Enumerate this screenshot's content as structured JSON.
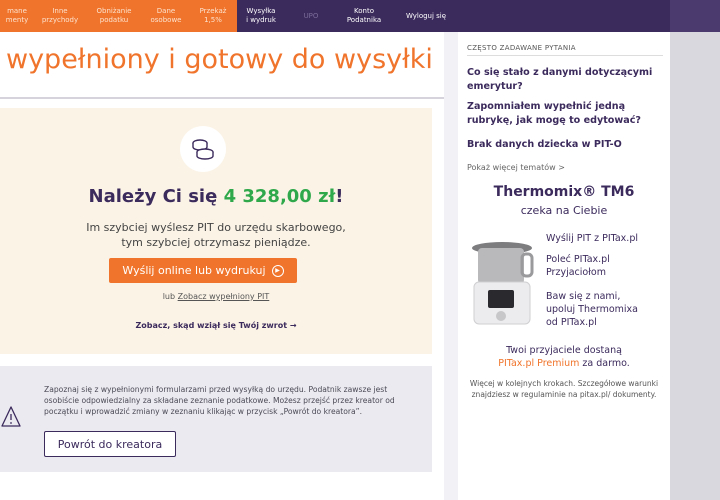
{
  "nav": {
    "steps": [
      {
        "label": "mane\nmenty"
      },
      {
        "label": "Inne\nprzychody"
      },
      {
        "label": "Obniżanie\npodatku"
      },
      {
        "label": "Dane\nosobowe"
      },
      {
        "label": "Przekaż\n1,5%"
      },
      {
        "label": "Wysyłka\ni wydruk"
      },
      {
        "label": "UPO"
      }
    ],
    "account": "Konto\nPodatnika",
    "logout": "Wyloguj się"
  },
  "main": {
    "headline": "wypełniony i gotowy do wysyłki",
    "refund_prefix": "Należy Ci się ",
    "refund_amount": "4 328,00 zł",
    "refund_suffix": "!",
    "sub_line1": "Im szybciej wyślesz PIT do urzędu skarbowego,",
    "sub_line2": "tym szybciej otrzymasz pieniądze.",
    "send_button": "Wyślij online lub wydrukuj",
    "or_text": "lub ",
    "see_pit_link": "Zobacz wypełniony PIT",
    "why_link": "Zobacz, skąd wziął się Twój zwrot",
    "info_text": "Zapoznaj się z wypełnionymi formularzami przed wysyłką do urzędu. Podatnik zawsze jest osobiście odpowiedzialny za składane zeznanie podatkowe. Możesz przejść przez kreator od początku i wprowadzić zmiany w zeznaniu klikając w przycisk „Powrót do kreatora”.",
    "back_button": "Powrót do kreatora"
  },
  "sidebar": {
    "faq_title": "CZĘSTO ZADAWANE PYTANIA",
    "faq": [
      "Co się stało z danymi dotyczącymi emerytur?",
      "Zapomniałem wypełnić jedną rubrykę, jak mogę to edytować?",
      "Brak danych dziecka w PIT-O"
    ],
    "more_topics": "Pokaż więcej tematów >",
    "promo_title": "Thermomix® TM6",
    "promo_subtitle": "czeka na Ciebie",
    "promo_steps": [
      "Wyślij PIT z PITax.pl",
      "Poleć PITax.pl\nPrzyjaciołom",
      "Baw się z nami,\nupoluj Thermomixa\nod PITax.pl"
    ],
    "friends_line1": "Twoi przyjaciele dostaną",
    "friends_premium": "PITax.pl Premium",
    "friends_suffix": " za darmo.",
    "fine_print": "Więcej w kolejnych krokach. Szczegółowe warunki znajdziesz w regulaminie na pitax.pl/ dokumenty."
  },
  "colors": {
    "accent": "#f0742b",
    "brand": "#3b2a5c",
    "amount": "#2ea84a"
  }
}
